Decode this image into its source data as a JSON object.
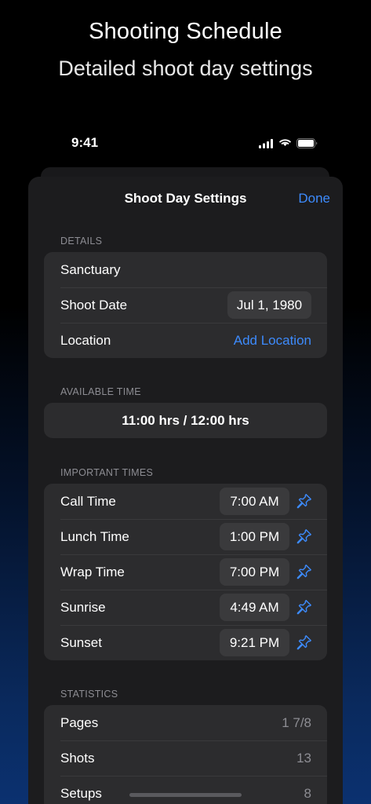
{
  "hero": {
    "title": "Shooting Schedule",
    "subtitle": "Detailed shoot day settings"
  },
  "status_bar": {
    "time": "9:41",
    "icons": [
      "cellular-signal-icon",
      "wifi-icon",
      "battery-icon"
    ]
  },
  "nav": {
    "title": "Shoot Day Settings",
    "done_label": "Done"
  },
  "details": {
    "header": "DETAILS",
    "name": "Sanctuary",
    "shoot_date_label": "Shoot Date",
    "shoot_date_value": "Jul 1, 1980",
    "location_label": "Location",
    "location_action": "Add Location"
  },
  "available_time": {
    "header": "AVAILABLE TIME",
    "value": "11:00 hrs / 12:00 hrs"
  },
  "important_times": {
    "header": "IMPORTANT TIMES",
    "rows": [
      {
        "label": "Call Time",
        "value": "7:00 AM",
        "icon": "pin-icon"
      },
      {
        "label": "Lunch Time",
        "value": "1:00 PM",
        "icon": "pin-icon"
      },
      {
        "label": "Wrap Time",
        "value": "7:00 PM",
        "icon": "pin-icon"
      },
      {
        "label": "Sunrise",
        "value": "4:49 AM",
        "icon": "pin-icon"
      },
      {
        "label": "Sunset",
        "value": "9:21 PM",
        "icon": "pin-icon"
      }
    ]
  },
  "statistics": {
    "header": "STATISTICS",
    "rows": [
      {
        "label": "Pages",
        "value": "1 7/8"
      },
      {
        "label": "Shots",
        "value": "13"
      },
      {
        "label": "Setups",
        "value": "8"
      }
    ]
  },
  "colors": {
    "accent": "#3d8bfd",
    "sheet_bg": "#1c1c1e",
    "group_bg": "#2c2c2e",
    "pill_bg": "#3a3a3c",
    "secondary_text": "#8d8d93"
  }
}
